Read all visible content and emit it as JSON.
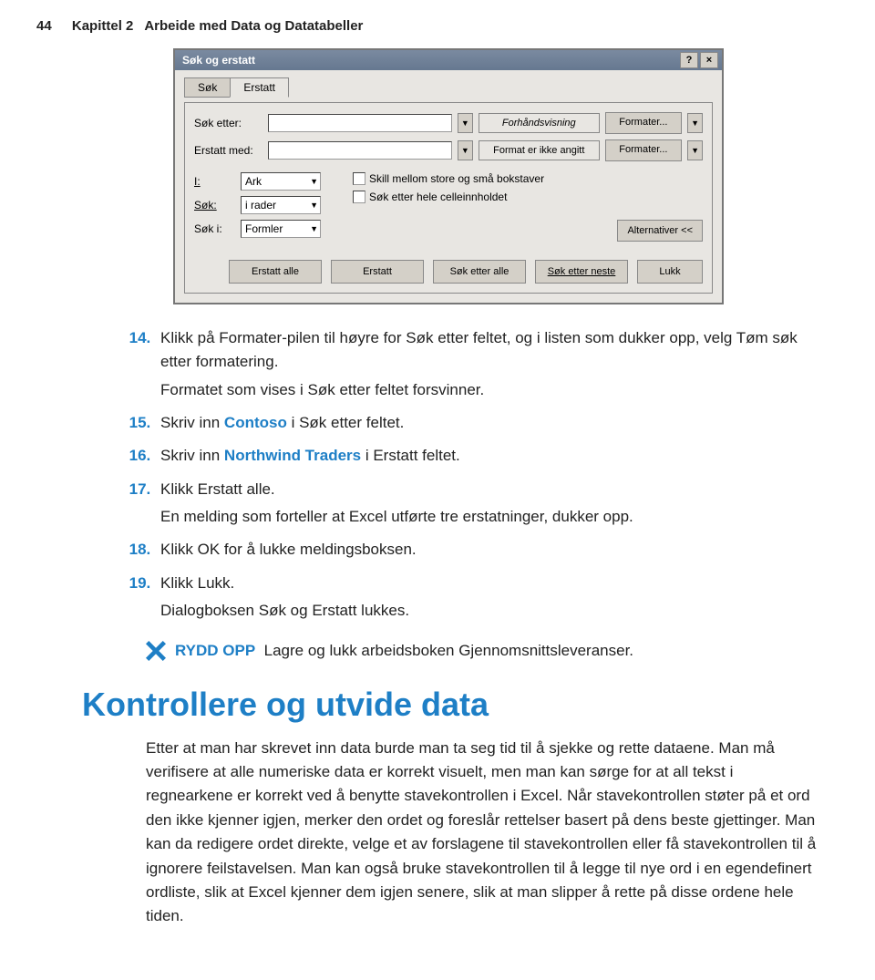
{
  "header": {
    "page_number": "44",
    "chapter_label": "Kapittel 2",
    "chapter_title": "Arbeide med Data og Datatabeller"
  },
  "dialog": {
    "title": "Søk og erstatt",
    "help_btn": "?",
    "close_btn": "×",
    "tab_search": "Søk",
    "tab_replace": "Erstatt",
    "search_after_label": "Søk etter:",
    "replace_with_label": "Erstatt med:",
    "preview_label": "Forhåndsvisning",
    "no_format_label": "Format er ikke angitt",
    "btn_format": "Formater...",
    "i_label": "I:",
    "i_value": "Ark",
    "search_label": "Søk:",
    "search_value": "i rader",
    "search_in_label": "Søk i:",
    "search_in_value": "Formler",
    "chk_case": "Skill mellom store og små bokstaver",
    "chk_whole": "Søk etter hele celleinnholdet",
    "btn_options": "Alternativer <<",
    "btn_replace_all": "Erstatt alle",
    "btn_replace": "Erstatt",
    "btn_find_all": "Søk etter alle",
    "btn_find_next": "Søk etter neste",
    "btn_close": "Lukk"
  },
  "steps": {
    "s14": "Klikk på Formater-pilen til høyre for Søk etter feltet, og i listen som dukker opp, velg Tøm søk etter formatering.",
    "s14_follow": "Formatet som vises i Søk etter feltet forsvinner.",
    "s15_pre": "Skriv inn ",
    "s15_kw": "Contoso",
    "s15_post": " i Søk etter feltet.",
    "s16_pre": "Skriv inn ",
    "s16_kw": "Northwind Traders",
    "s16_post": " i Erstatt feltet.",
    "s17": "Klikk Erstatt alle.",
    "s17_follow": "En melding som forteller at Excel utførte tre erstatninger, dukker opp.",
    "s18": "Klikk OK for å lukke meldingsboksen.",
    "s19": "Klikk Lukk.",
    "s19_follow": "Dialogboksen Søk og Erstatt lukkes."
  },
  "cleanup": {
    "label": "RYDD OPP",
    "text": "Lagre og lukk arbeidsboken Gjennomsnittsleveranser."
  },
  "section": {
    "heading": "Kontrollere og utvide data",
    "para": "Etter at man har skrevet inn data burde man ta seg tid til å sjekke og rette dataene. Man må verifisere at alle numeriske data er korrekt visuelt, men man kan sørge for at all tekst i regnearkene er korrekt ved å benytte stavekontrollen i Excel. Når stavekontrollen støter på et ord den ikke kjenner igjen, merker den ordet og foreslår rettelser basert på dens beste gjettinger. Man kan da redigere ordet direkte, velge et av forslagene til stavekontrollen eller få stavekontrollen til å ignorere feilstavelsen. Man kan også bruke stavekontrollen til å legge til nye ord i en egendefinert ordliste, slik at Excel kjenner dem igjen senere, slik at man slipper å rette på disse ordene hele tiden."
  }
}
